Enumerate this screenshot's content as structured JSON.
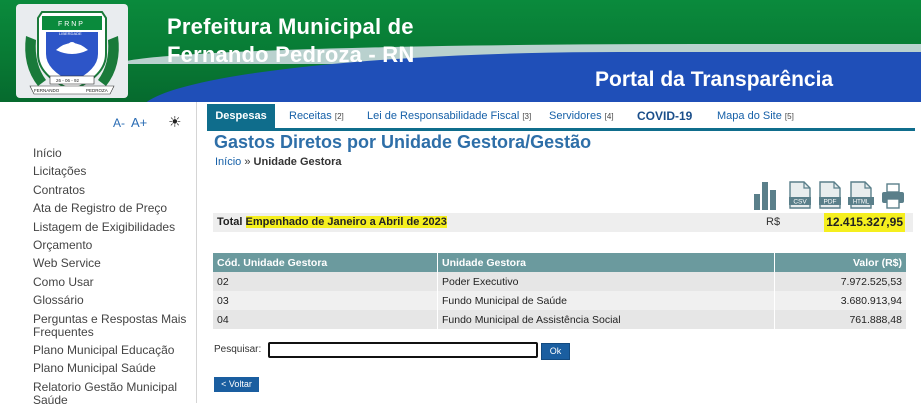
{
  "header": {
    "title_line1": "Prefeitura Municipal de",
    "title_line2": "Fernando Pedroza - RN",
    "portal": "Portal da Transparência",
    "logo": {
      "top_text": "F R N P",
      "scroll_text": "LIBERDADE",
      "date": "26 - 06 - 92",
      "left_text": "FERNANDO",
      "right_text": "PEDROZA"
    }
  },
  "sidebar": {
    "font_decrease": "A-",
    "font_increase": "A+",
    "contrast_icon": "sun-icon",
    "menu": [
      "Início",
      "Licitações",
      "Contratos",
      "Ata de Registro de Preço",
      "Listagem de Exigibilidades",
      "Orçamento",
      "Web Service",
      "Como Usar",
      "Glossário",
      "Perguntas e Respostas Mais Frequentes",
      "Plano Municipal Educação",
      "Plano Municipal Saúde",
      "Relatorio Gestão Municipal Saúde"
    ]
  },
  "tabs": [
    {
      "label": "Despesas",
      "count": ""
    },
    {
      "label": "Receitas",
      "count": "[2]"
    },
    {
      "label": "Lei de Responsabilidade Fiscal",
      "count": "[3]"
    },
    {
      "label": "Servidores",
      "count": "[4]"
    },
    {
      "label": "COVID-19",
      "count": ""
    },
    {
      "label": "Mapa do Site",
      "count": "[5]"
    }
  ],
  "main": {
    "title": "Gastos Diretos por Unidade Gestora/Gestão",
    "breadcrumb": {
      "home": "Início",
      "sep": " » ",
      "current": "Unidade Gestora"
    },
    "export_icons": [
      "chart-icon",
      "csv-icon",
      "pdf-icon",
      "html-icon",
      "print-icon"
    ],
    "export_labels": {
      "csv": "CSV",
      "pdf": "PDF",
      "html": "HTML"
    },
    "total": {
      "prefix": "Total ",
      "highlight": "Empenhado de Janeiro a Abril de 2023",
      "currency": "R$",
      "value": "12.415.327,95"
    },
    "table": {
      "headers": [
        "Cód. Unidade Gestora",
        "Unidade Gestora",
        "Valor (R$)"
      ],
      "rows": [
        [
          "02",
          "Poder Executivo",
          "7.972.525,53"
        ],
        [
          "03",
          "Fundo Municipal de Saúde",
          "3.680.913,94"
        ],
        [
          "04",
          "Fundo Municipal de Assistência Social",
          "761.888,48"
        ]
      ]
    },
    "search": {
      "label": "Pesquisar:",
      "value": "",
      "button": "Ok"
    },
    "back_button": "< Voltar"
  },
  "colors": {
    "header_green": "#0a8a3c",
    "header_blue": "#1f4fb8",
    "tab_active": "#0f6d8c",
    "table_header": "#6b9a9e",
    "highlight": "#f5ef1e",
    "button": "#1a5ea0"
  }
}
